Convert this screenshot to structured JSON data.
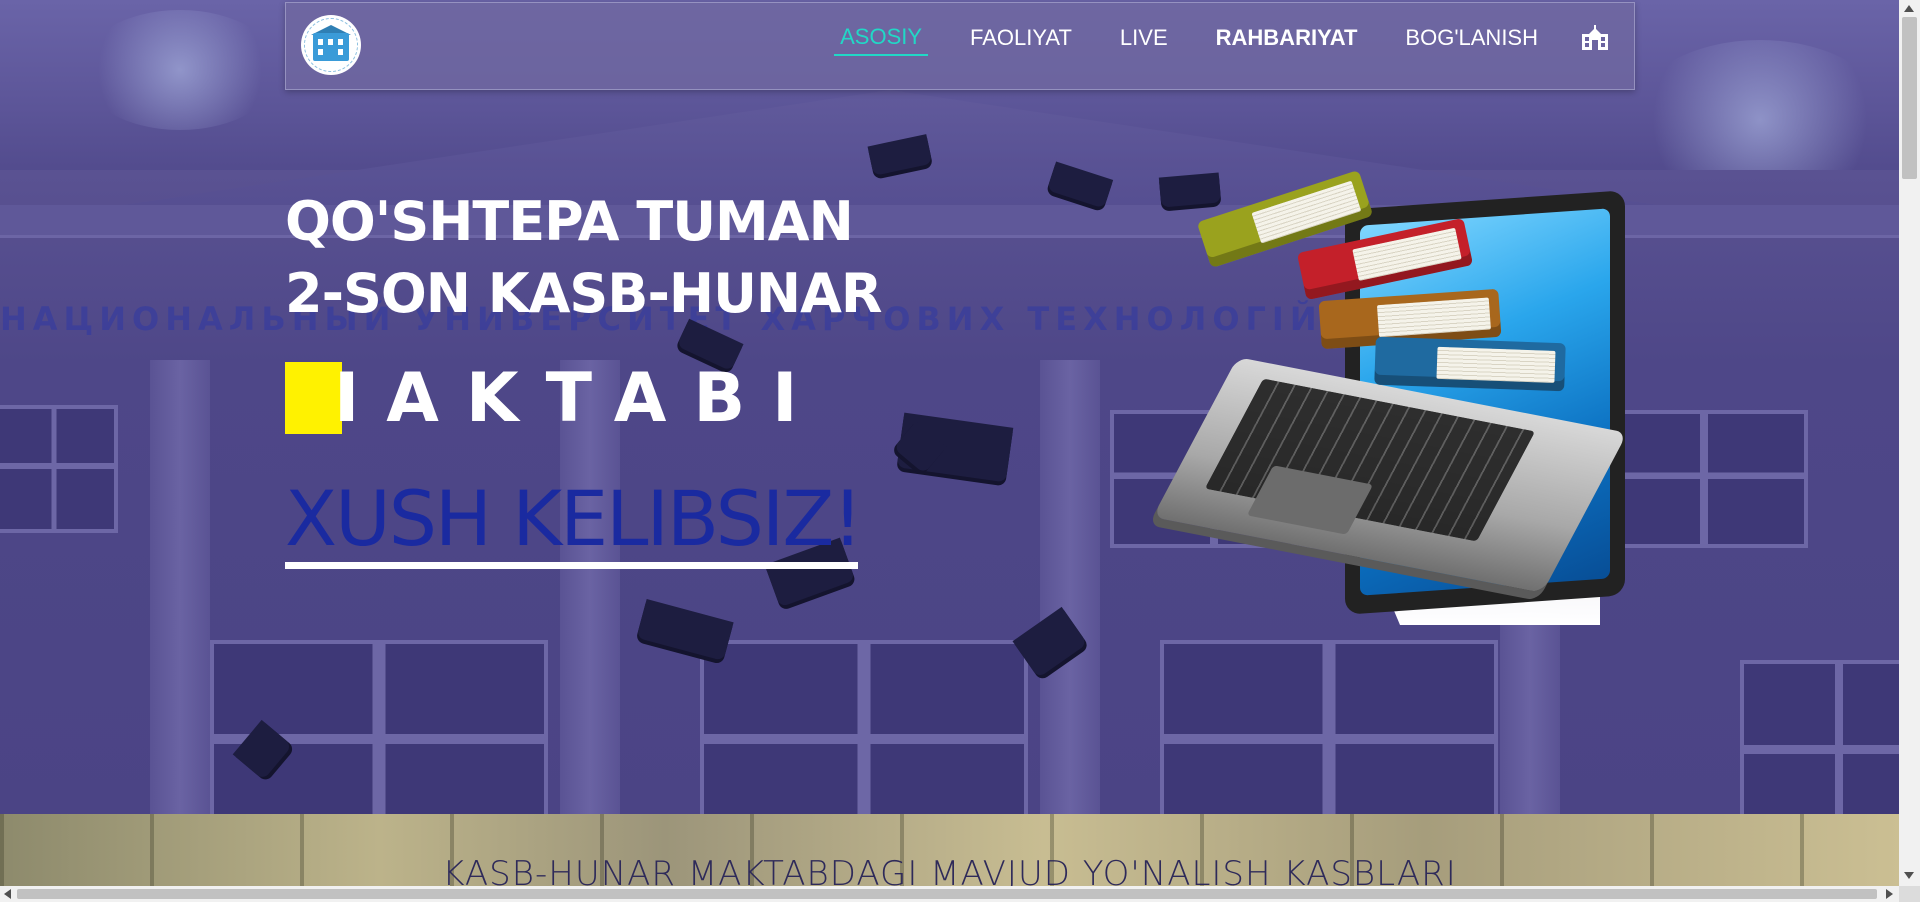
{
  "nav": {
    "links": [
      {
        "label": "ASOSIY",
        "active": true
      },
      {
        "label": "FAOLIYAT",
        "active": false
      },
      {
        "label": "LIVE",
        "active": false
      },
      {
        "label": "RAHBARIYAT",
        "active": false
      },
      {
        "label": "BOG'LANISH",
        "active": false
      }
    ],
    "school_icon": "school-icon",
    "logo_icon": "school-building-logo"
  },
  "hero": {
    "title_line1": "QO'SHTEPA TUMAN",
    "title_line2": "2-SON KASB-HUNAR",
    "typed_text": "IAKTABI",
    "welcome": "XUSH KELIBSIZ!",
    "background_building_text": "НАЦИОНАЛЬНЫЙ УНИВЕРСИТЕТ ХАРЧОВИХ ТЕХНОЛОГІЙ",
    "illustration": "laptop-with-books"
  },
  "section2": {
    "title": "KASB-HUNAR MAKTABDAGI MAVJUD YO'NALISH KASBLARI"
  },
  "colors": {
    "active_nav": "#21d8c6",
    "cursor_block": "#fff200",
    "welcome_text": "#1a2aa0",
    "hero_overlay": "#4d4388"
  }
}
